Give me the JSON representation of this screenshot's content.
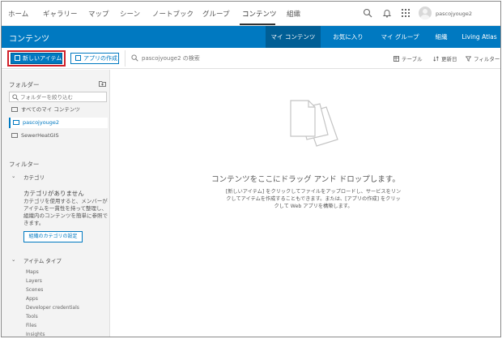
{
  "topnav": {
    "items": [
      "ホーム",
      "ギャラリー",
      "マップ",
      "シーン",
      "ノートブック",
      "グループ",
      "コンテンツ",
      "組織"
    ],
    "active": "コンテンツ",
    "username": "pascojyouge2"
  },
  "header": {
    "title": "コンテンツ",
    "tabs": [
      "マイ コンテンツ",
      "お気に入り",
      "マイ グループ",
      "組織",
      "Living Atlas"
    ],
    "active_tab": "マイ コンテンツ"
  },
  "toolbar": {
    "new_item_label": "新しいアイテム",
    "create_app_label": "アプリの作成",
    "search_placeholder": "pascojyouge2 の検索",
    "table_label": "テーブル",
    "sort_label": "更新日",
    "filter_label": "フィルター"
  },
  "sidebar": {
    "folders_heading": "フォルダー",
    "folder_filter_placeholder": "フォルダーを絞り込む",
    "folders": [
      "すべてのマイ コンテンツ",
      "pascojyouge2",
      "SewerHeatGIS"
    ],
    "selected_folder": "pascojyouge2",
    "filters_heading": "フィルター",
    "category_heading": "カテゴリ",
    "no_category_title": "カテゴリがありません",
    "no_category_text": "カテゴリを使用すると、メンバーがアイテムを一貫性を持って整理し、組織内のコンテンツを簡単に参照できます。",
    "category_button": "組織のカテゴリの設定",
    "item_type_heading": "アイテム タイプ",
    "item_types": [
      "Maps",
      "Layers",
      "Scenes",
      "Apps",
      "Developer credentials",
      "Tools",
      "Files",
      "Insights"
    ]
  },
  "main": {
    "drop_title": "コンテンツをここにドラッグ アンド ドロップします。",
    "drop_desc": "[新しいアイテム] をクリックしてファイルをアップロードし、サービスをリンクしてアイテムを作成することもできます。または、[アプリの作成] をクリックして Web アプリを構築します。"
  },
  "colors": {
    "brand_blue": "#0079c1",
    "active_tab_blue": "#005e95",
    "highlight_red": "#d1202a"
  }
}
